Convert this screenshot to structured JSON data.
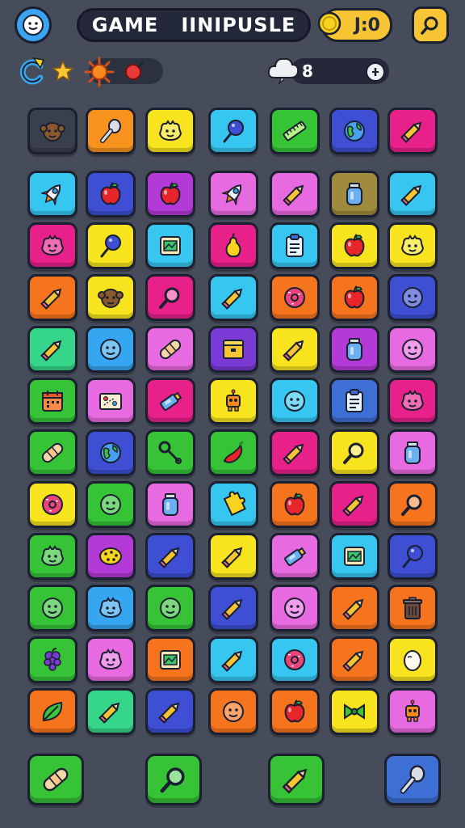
{
  "header": {
    "title_left": "GAME",
    "title_right": "IINIPUSLE",
    "coin_value": "J:0",
    "cloud_value": "8"
  },
  "colors": {
    "background": "#474c5a",
    "pill_dark": "#23283a",
    "gold": "#f7c533"
  },
  "grid_top": [
    {
      "color": "#3a3f4d",
      "icon": "monkey-face-icon"
    },
    {
      "color": "#f7921e",
      "icon": "spoon-icon"
    },
    {
      "color": "#f7e31e",
      "icon": "creature-icon"
    },
    {
      "color": "#36c6f0",
      "icon": "lollipop-icon"
    },
    {
      "color": "#36c436",
      "icon": "ruler-icon"
    },
    {
      "color": "#3e4fd4",
      "icon": "globe-icon"
    },
    {
      "color": "#e8208a",
      "icon": "pencil-icon"
    }
  ],
  "grid": [
    [
      {
        "color": "#36c6f0",
        "icon": "rocket-icon"
      },
      {
        "color": "#3e4fd4",
        "icon": "apple-icon"
      },
      {
        "color": "#b33ad6",
        "icon": "apple-icon"
      },
      {
        "color": "#e86ae0",
        "icon": "rocket-icon"
      },
      {
        "color": "#e86ae0",
        "icon": "pencil-icon"
      },
      {
        "color": "#a08a3e",
        "icon": "bottle-icon"
      },
      {
        "color": "#36c6f0",
        "icon": "pencil-icon"
      }
    ],
    [
      {
        "color": "#e8208a",
        "icon": "creature-icon"
      },
      {
        "color": "#f7e31e",
        "icon": "lollipop-icon"
      },
      {
        "color": "#36c6f0",
        "icon": "frame-icon"
      },
      {
        "color": "#e8208a",
        "icon": "pear-icon"
      },
      {
        "color": "#36c6f0",
        "icon": "clipboard-icon"
      },
      {
        "color": "#f7e31e",
        "icon": "apple-icon"
      },
      {
        "color": "#f7e31e",
        "icon": "creature-icon"
      }
    ],
    [
      {
        "color": "#f7741e",
        "icon": "pencil-icon"
      },
      {
        "color": "#f7e31e",
        "icon": "monkey-face-icon"
      },
      {
        "color": "#e8208a",
        "icon": "magnifier-icon"
      },
      {
        "color": "#36c6f0",
        "icon": "pencil-icon"
      },
      {
        "color": "#f7741e",
        "icon": "donut-icon"
      },
      {
        "color": "#f7741e",
        "icon": "apple-icon"
      },
      {
        "color": "#3e4fd4",
        "icon": "face-icon"
      }
    ],
    [
      {
        "color": "#36d68a",
        "icon": "pencil-icon"
      },
      {
        "color": "#36a6f0",
        "icon": "face-icon"
      },
      {
        "color": "#e86ae0",
        "icon": "bandage-icon"
      },
      {
        "color": "#7a3ad6",
        "icon": "box-icon"
      },
      {
        "color": "#f7e31e",
        "icon": "pencil-icon"
      },
      {
        "color": "#b33ad6",
        "icon": "bottle-icon"
      },
      {
        "color": "#e86ae0",
        "icon": "face-icon"
      }
    ],
    [
      {
        "color": "#36c436",
        "icon": "calendar-icon"
      },
      {
        "color": "#e86ae0",
        "icon": "map-icon"
      },
      {
        "color": "#e8208a",
        "icon": "tube-icon"
      },
      {
        "color": "#f7e31e",
        "icon": "robot-icon"
      },
      {
        "color": "#36c6f0",
        "icon": "face-icon"
      },
      {
        "color": "#3e6fd4",
        "icon": "clipboard-icon"
      },
      {
        "color": "#e8208a",
        "icon": "creature-icon"
      }
    ],
    [
      {
        "color": "#36c436",
        "icon": "bandage-icon"
      },
      {
        "color": "#3e4fd4",
        "icon": "globe-icon"
      },
      {
        "color": "#36c436",
        "icon": "key-icon"
      },
      {
        "color": "#36c436",
        "icon": "pepper-icon"
      },
      {
        "color": "#e8208a",
        "icon": "pencil-icon"
      },
      {
        "color": "#f7e31e",
        "icon": "magnifier-icon"
      },
      {
        "color": "#e86ae0",
        "icon": "bottle-icon"
      }
    ],
    [
      {
        "color": "#f7e31e",
        "icon": "donut-icon"
      },
      {
        "color": "#36c436",
        "icon": "face-icon"
      },
      {
        "color": "#e86ae0",
        "icon": "bottle-icon"
      },
      {
        "color": "#36c6f0",
        "icon": "puzzle-icon"
      },
      {
        "color": "#f7741e",
        "icon": "apple-icon"
      },
      {
        "color": "#e8208a",
        "icon": "pencil-icon"
      },
      {
        "color": "#f7741e",
        "icon": "magnifier-icon"
      }
    ],
    [
      {
        "color": "#36c436",
        "icon": "creature-icon"
      },
      {
        "color": "#b33ad6",
        "icon": "cookie-icon"
      },
      {
        "color": "#3e4fd4",
        "icon": "pencil-icon"
      },
      {
        "color": "#f7e31e",
        "icon": "pencil-icon"
      },
      {
        "color": "#e86ae0",
        "icon": "tube-icon"
      },
      {
        "color": "#36c6f0",
        "icon": "frame-icon"
      },
      {
        "color": "#3e4fd4",
        "icon": "lollipop-icon"
      }
    ],
    [
      {
        "color": "#36c436",
        "icon": "face-icon"
      },
      {
        "color": "#36a6f0",
        "icon": "creature-icon"
      },
      {
        "color": "#36c436",
        "icon": "face-icon"
      },
      {
        "color": "#3e4fd4",
        "icon": "pencil-icon"
      },
      {
        "color": "#e86ae0",
        "icon": "face-icon"
      },
      {
        "color": "#f7741e",
        "icon": "pencil-icon"
      },
      {
        "color": "#f7741e",
        "icon": "trash-icon"
      }
    ],
    [
      {
        "color": "#36c436",
        "icon": "grapes-icon"
      },
      {
        "color": "#e86ae0",
        "icon": "creature-icon"
      },
      {
        "color": "#f7741e",
        "icon": "frame-icon"
      },
      {
        "color": "#36c6f0",
        "icon": "pencil-icon"
      },
      {
        "color": "#36c6f0",
        "icon": "donut-icon"
      },
      {
        "color": "#f7741e",
        "icon": "pencil-icon"
      },
      {
        "color": "#f7e31e",
        "icon": "egg-icon"
      }
    ],
    [
      {
        "color": "#f7741e",
        "icon": "leaf-icon"
      },
      {
        "color": "#36d68a",
        "icon": "pencil-icon"
      },
      {
        "color": "#3e4fd4",
        "icon": "pencil-icon"
      },
      {
        "color": "#f7741e",
        "icon": "face-icon"
      },
      {
        "color": "#f7741e",
        "icon": "apple-icon"
      },
      {
        "color": "#f7e31e",
        "icon": "bow-icon"
      },
      {
        "color": "#e86ae0",
        "icon": "robot-icon"
      }
    ]
  ],
  "bottom_buttons": [
    {
      "color": "#36c436",
      "icon": "bandage-icon"
    },
    {
      "color": "#36c436",
      "icon": "magnifier-icon"
    },
    {
      "color": "#36c436",
      "icon": "pencil-icon"
    },
    {
      "color": "#3e6fd4",
      "icon": "spoon-icon"
    }
  ]
}
